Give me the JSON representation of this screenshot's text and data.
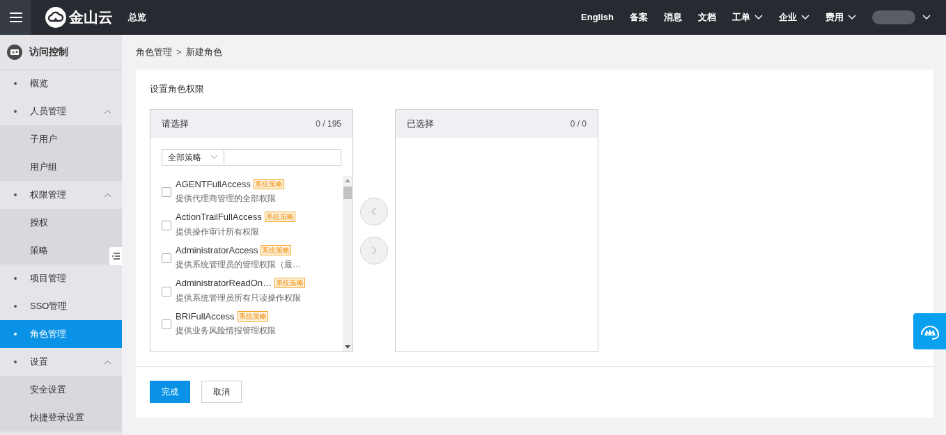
{
  "top_bar": {
    "logo_text": "金山云",
    "nav_left": "总览",
    "nav_right": [
      {
        "label": "English",
        "dropdown": false
      },
      {
        "label": "备案",
        "dropdown": false
      },
      {
        "label": "消息",
        "dropdown": false
      },
      {
        "label": "文档",
        "dropdown": false
      },
      {
        "label": "工单",
        "dropdown": true
      },
      {
        "label": "企业",
        "dropdown": true
      },
      {
        "label": "费用",
        "dropdown": true
      }
    ]
  },
  "sidebar": {
    "title": "访问控制",
    "items": [
      {
        "label": "概览",
        "selected": false
      },
      {
        "label": "人员管理",
        "selected": false,
        "expanded": true,
        "children": [
          {
            "label": "子用户",
            "selected": false
          },
          {
            "label": "用户组",
            "selected": false
          }
        ]
      },
      {
        "label": "权限管理",
        "selected": false,
        "expanded": true,
        "children": [
          {
            "label": "授权",
            "selected": false
          },
          {
            "label": "策略",
            "selected": false
          }
        ]
      },
      {
        "label": "项目管理",
        "selected": false
      },
      {
        "label": "SSO管理",
        "selected": false
      },
      {
        "label": "角色管理",
        "selected": true
      },
      {
        "label": "设置",
        "selected": false,
        "expanded": true,
        "children": [
          {
            "label": "安全设置",
            "selected": false
          },
          {
            "label": "快捷登录设置",
            "selected": false
          }
        ]
      }
    ]
  },
  "breadcrumb": [
    "角色管理",
    "新建角色"
  ],
  "breadcrumb_separator": ">",
  "section_title": "设置角色权限",
  "source_panel": {
    "title": "请选择",
    "count": "0 / 195",
    "filter": "全部策略",
    "items": [
      {
        "name": "AGENTFullAccess",
        "badge": "系统策略",
        "description": "提供代理商管理的全部权限",
        "checked": false
      },
      {
        "name": "ActionTrailFullAccess",
        "badge": "系统策略",
        "description": "提供操作审计所有权限",
        "checked": false
      },
      {
        "name": "AdministratorAccess",
        "badge": "系统策略",
        "description": "提供系统管理员的管理权限（最…",
        "checked": false
      },
      {
        "name": "AdministratorReadOn…",
        "badge": "系统策略",
        "description": "提供系统管理员所有只读操作权限",
        "checked": false
      },
      {
        "name": "BRIFullAccess",
        "badge": "系统策略",
        "description": "提供业务风险情报管理权限",
        "checked": false
      }
    ]
  },
  "target_panel": {
    "title": "已选择",
    "count": "0 / 0"
  },
  "buttons": [
    {
      "label": "完成",
      "kind": "primary"
    },
    {
      "label": "取消",
      "kind": "secondary"
    }
  ]
}
